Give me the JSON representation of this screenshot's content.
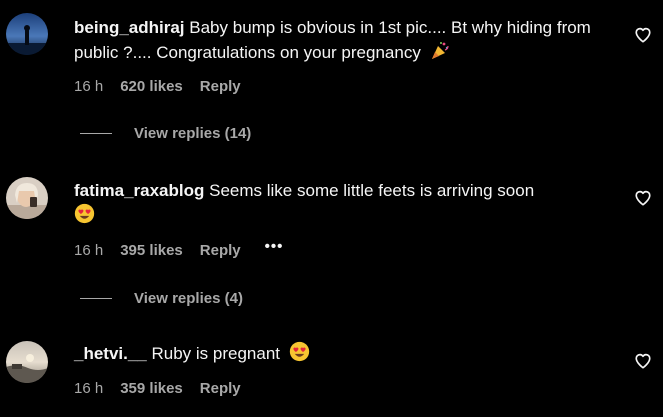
{
  "comments": [
    {
      "username": "being_adhiraj",
      "text": "Baby bump is obvious in 1st pic.... Bt why hiding from public ?.... Congratulations on your pregnancy",
      "emoji": "party-popper",
      "time": "16 h",
      "likes": "620 likes",
      "reply_label": "Reply",
      "view_replies": "View replies (14)"
    },
    {
      "username": "fatima_raxablog",
      "text": "Seems like some little feets is arriving soon",
      "emoji": "heart-eyes",
      "time": "16 h",
      "likes": "395 likes",
      "reply_label": "Reply",
      "more_label": "•••",
      "view_replies": "View replies (4)"
    },
    {
      "username": "_hetvi.__",
      "text": "Ruby is pregnant",
      "emoji": "heart-eyes",
      "time": "16 h",
      "likes": "359 likes",
      "reply_label": "Reply"
    }
  ],
  "icons": {
    "like": "heart-outline-icon",
    "more": "more-options-icon"
  },
  "colors": {
    "background": "#000000",
    "primary_text": "#f5f5f5",
    "secondary_text": "#a8a8a8"
  }
}
